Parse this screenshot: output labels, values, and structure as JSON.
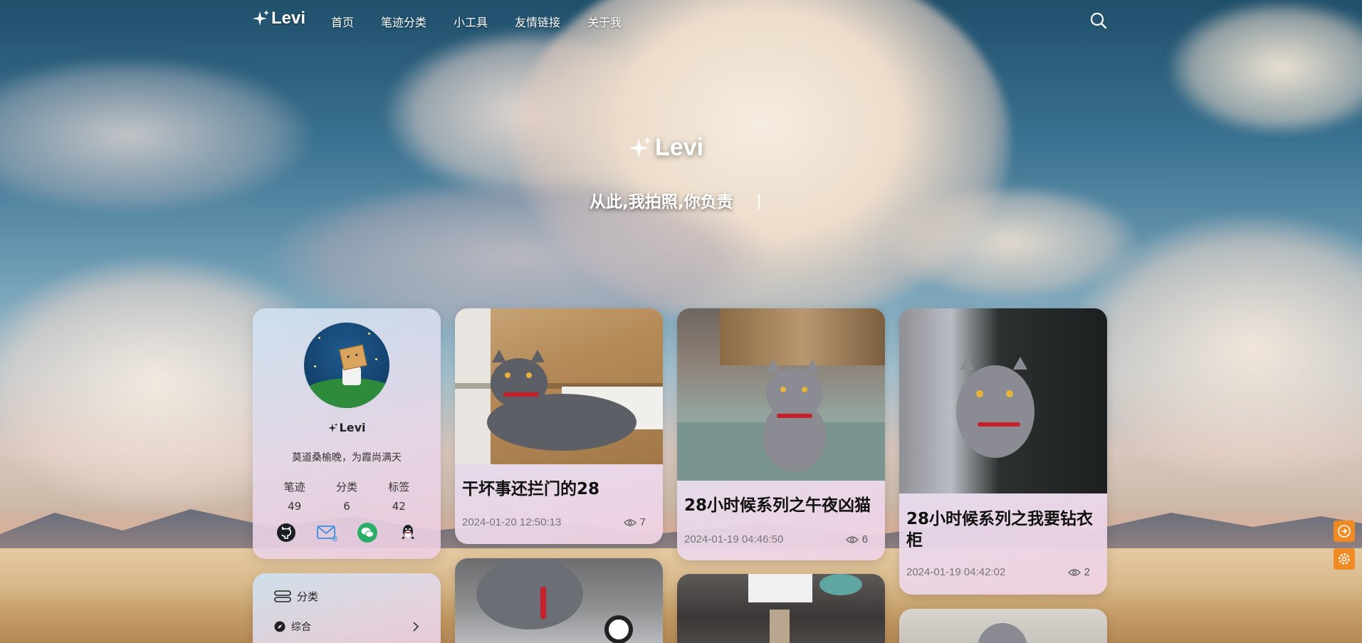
{
  "nav": {
    "brand": "Levi",
    "menu": [
      "首页",
      "笔迹分类",
      "小工具",
      "友情链接",
      "关于我"
    ]
  },
  "hero": {
    "title": "Levi",
    "subtitle": "从此,我拍照,你负责"
  },
  "profile": {
    "name": "Levi",
    "motto": "莫道桑榆晚，为霞尚满天",
    "stats": [
      {
        "label": "笔迹",
        "value": "49"
      },
      {
        "label": "分类",
        "value": "6"
      },
      {
        "label": "标签",
        "value": "42"
      }
    ],
    "socials": [
      "github-icon",
      "email-icon",
      "wechat-icon",
      "qq-icon"
    ]
  },
  "categories": {
    "heading": "分类",
    "items": [
      {
        "label": "综合"
      }
    ]
  },
  "posts": [
    {
      "title": "干坏事还拦门的28",
      "date": "2024-01-20 12:50:13",
      "views": "7"
    },
    {
      "title": "28小时候系列之午夜凶猫",
      "date": "2024-01-19 04:46:50",
      "views": "6"
    },
    {
      "title": "28小时候系列之我要钻衣柜",
      "date": "2024-01-19 04:42:02",
      "views": "2"
    }
  ],
  "colors": {
    "accent": "#f08a24",
    "text": "#111111",
    "muted": "#777777"
  }
}
